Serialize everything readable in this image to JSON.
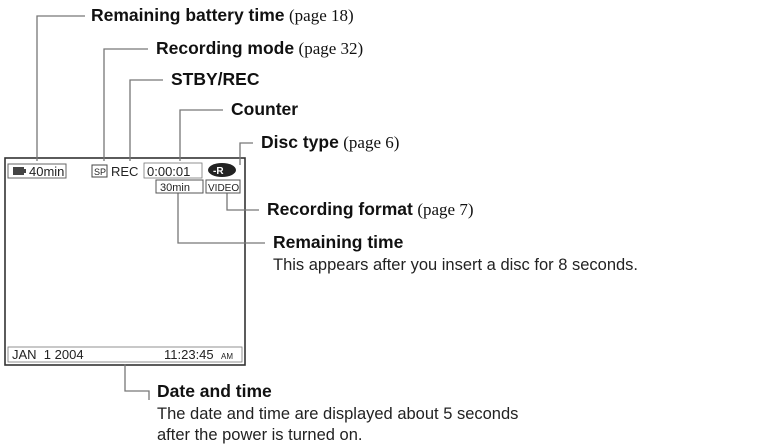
{
  "screen": {
    "battery": "40min",
    "rec_mode": "SP",
    "status": "REC",
    "counter": "0:00:01",
    "disc_badge": "-R",
    "remaining": "30min",
    "format": "VIDEO",
    "date": "JAN  1 2004",
    "time": "11:23:45",
    "ampm": "AM"
  },
  "callouts": {
    "battery": {
      "label": "Remaining battery time",
      "page": "(page 18)"
    },
    "rec_mode": {
      "label": "Recording mode",
      "page": "(page 32)"
    },
    "stby_rec": {
      "label": "STBY/REC"
    },
    "counter": {
      "label": "Counter"
    },
    "disc_type": {
      "label": "Disc type",
      "page": "(page 6)"
    },
    "rec_format": {
      "label": "Recording format",
      "page": "(page 7)"
    },
    "remaining_time": {
      "label": "Remaining time",
      "desc": "This appears after you insert a disc for 8 seconds."
    },
    "date_time": {
      "label": "Date and time",
      "desc_line1": "The date and time are displayed about 5 seconds",
      "desc_line2": "after the power is turned on."
    }
  }
}
